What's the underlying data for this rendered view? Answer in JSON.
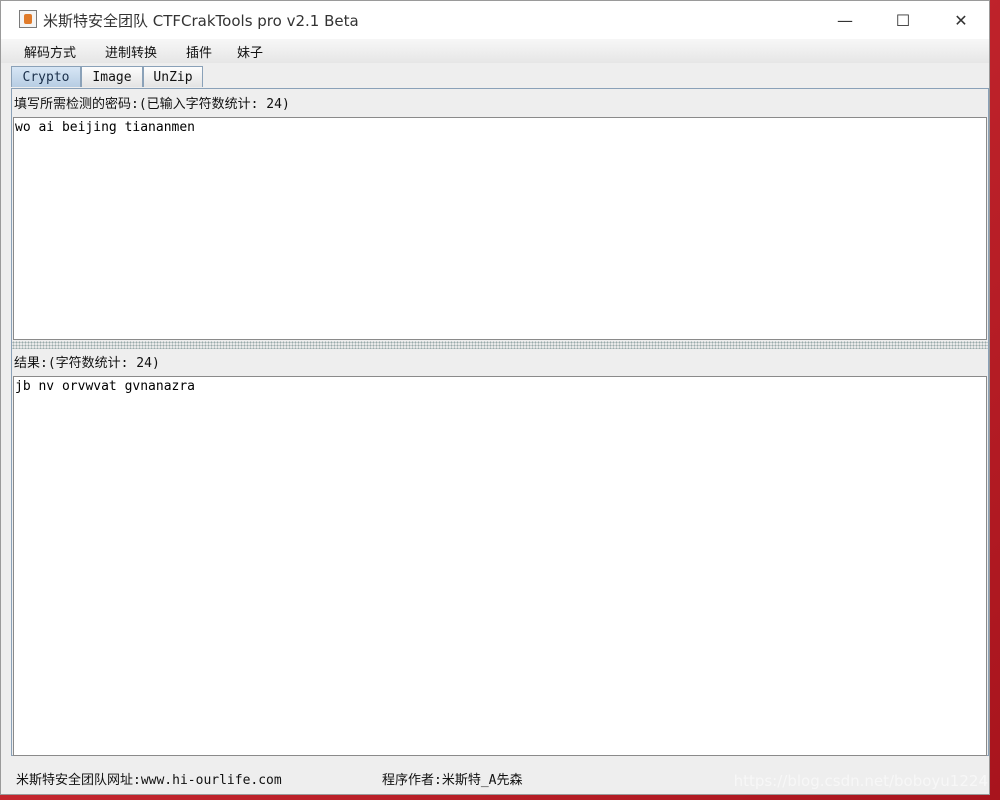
{
  "window": {
    "title": "米斯特安全团队 CTFCrakTools pro v2.1 Beta",
    "icon": "java-icon",
    "controls": {
      "minimize": "—",
      "maximize": "☐",
      "close": "✕"
    }
  },
  "menu": {
    "items": [
      "解码方式",
      "进制转换",
      "插件",
      "妹子"
    ]
  },
  "tabs": [
    {
      "label": "Crypto",
      "active": true
    },
    {
      "label": "Image",
      "active": false
    },
    {
      "label": "UnZip",
      "active": false
    }
  ],
  "input_panel": {
    "label": "填写所需检测的密码:(已输入字符数统计: 24)",
    "value": "wo ai beijing tiananmen"
  },
  "result_panel": {
    "label": "结果:(字符数统计: 24)",
    "value": "jb nv orvwvat gvnanazra"
  },
  "status": {
    "site": "米斯特安全团队网址:www.hi-ourlife.com",
    "author": "程序作者:米斯特_A先森"
  },
  "watermark": "https://blog.csdn.net/boboyu1224"
}
